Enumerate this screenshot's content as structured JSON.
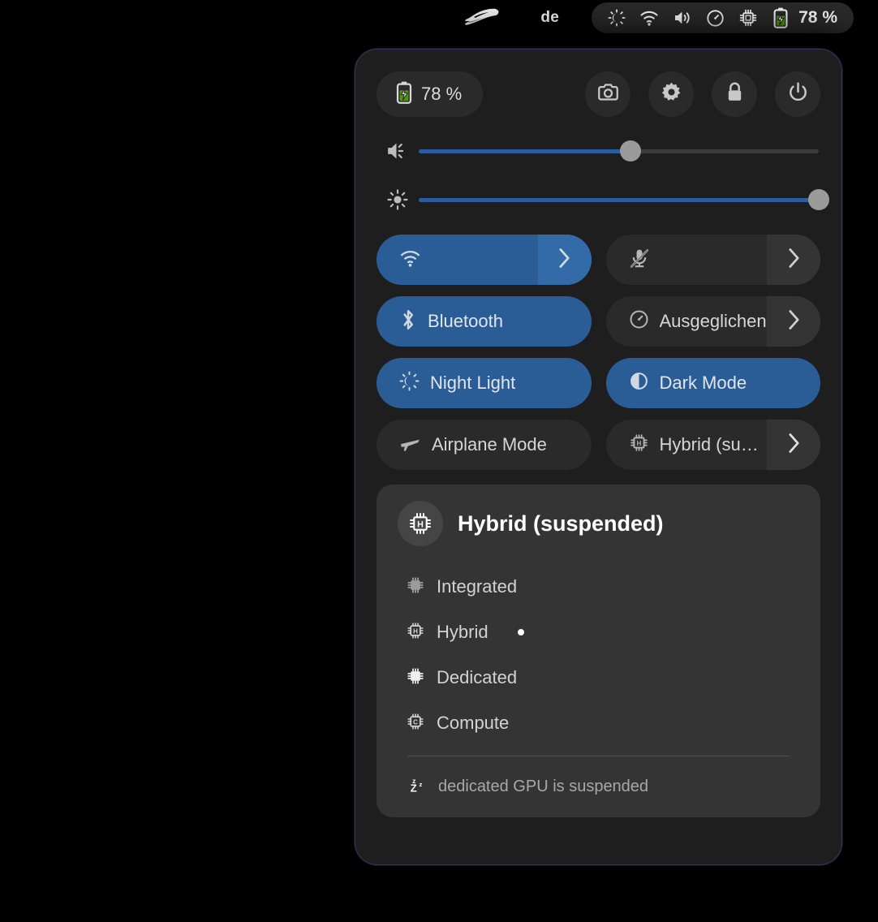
{
  "topbar": {
    "logo_icon": "rog-eye-logo",
    "keyboard_layout": "de",
    "indicators": [
      {
        "icon": "night-light-icon",
        "name": "night-light-indicator"
      },
      {
        "icon": "wifi-icon",
        "name": "wifi-indicator"
      },
      {
        "icon": "volume-icon",
        "name": "volume-indicator"
      },
      {
        "icon": "power-profile-icon",
        "name": "power-profile-indicator"
      },
      {
        "icon": "gpu-chip-icon",
        "name": "gpu-mode-indicator"
      }
    ],
    "battery_icon": "battery-charging-icon",
    "battery_percent": "78 %"
  },
  "panel": {
    "battery": {
      "icon": "battery-charging-icon",
      "label": "78 %"
    },
    "actions": [
      {
        "name": "screenshot-button",
        "icon": "camera-icon"
      },
      {
        "name": "settings-button",
        "icon": "gear-icon"
      },
      {
        "name": "lock-button",
        "icon": "lock-icon"
      },
      {
        "name": "power-button",
        "icon": "power-icon"
      }
    ],
    "sliders": [
      {
        "name": "volume-slider",
        "icon": "volume-icon",
        "value": 53
      },
      {
        "name": "brightness-slider",
        "icon": "brightness-icon",
        "value": 100
      }
    ],
    "toggles": [
      {
        "name": "wifi-toggle",
        "icon": "wifi-icon",
        "label": "",
        "active": true,
        "arrow": true
      },
      {
        "name": "microphone-toggle",
        "icon": "mic-disabled-icon",
        "label": "",
        "active": false,
        "arrow": true
      },
      {
        "name": "bluetooth-toggle",
        "icon": "bluetooth-icon",
        "label": "Bluetooth",
        "active": true,
        "arrow": false
      },
      {
        "name": "power-profile-toggle",
        "icon": "power-profile-icon",
        "label": "Ausgeglichen",
        "active": false,
        "arrow": true
      },
      {
        "name": "night-light-toggle",
        "icon": "night-light-icon",
        "label": "Night Light",
        "active": true,
        "arrow": false
      },
      {
        "name": "dark-mode-toggle",
        "icon": "dark-mode-icon",
        "label": "Dark Mode",
        "active": true,
        "arrow": false
      },
      {
        "name": "airplane-mode-toggle",
        "icon": "airplane-icon",
        "label": "Airplane Mode",
        "active": false,
        "arrow": false
      },
      {
        "name": "gpu-mode-toggle",
        "icon": "gpu-chip-icon",
        "label": "Hybrid (sus…)",
        "active": false,
        "arrow": true
      }
    ],
    "gpu_submenu": {
      "title": "Hybrid (suspended)",
      "title_icon": "gpu-hybrid-chip-icon",
      "options": [
        {
          "name": "gpu-option-integrated",
          "icon": "chip-integrated-icon",
          "label": "Integrated",
          "selected": false
        },
        {
          "name": "gpu-option-hybrid",
          "icon": "chip-hybrid-icon",
          "label": "Hybrid",
          "selected": true
        },
        {
          "name": "gpu-option-dedicated",
          "icon": "chip-dedicated-icon",
          "label": "Dedicated",
          "selected": false
        },
        {
          "name": "gpu-option-compute",
          "icon": "chip-compute-icon",
          "label": "Compute",
          "selected": false
        }
      ],
      "note_icon": "sleep-zzz-icon",
      "note": "dedicated GPU is suspended"
    }
  },
  "colors": {
    "accent_blue": "#2a5c96",
    "accent_blue_arrow": "#336aa8",
    "panel_bg": "#1e1e1e",
    "tile_bg": "#2a2a2a",
    "submenu_bg": "#343434",
    "battery_green": "#4e9a06",
    "panel_border": "#3a3560"
  }
}
